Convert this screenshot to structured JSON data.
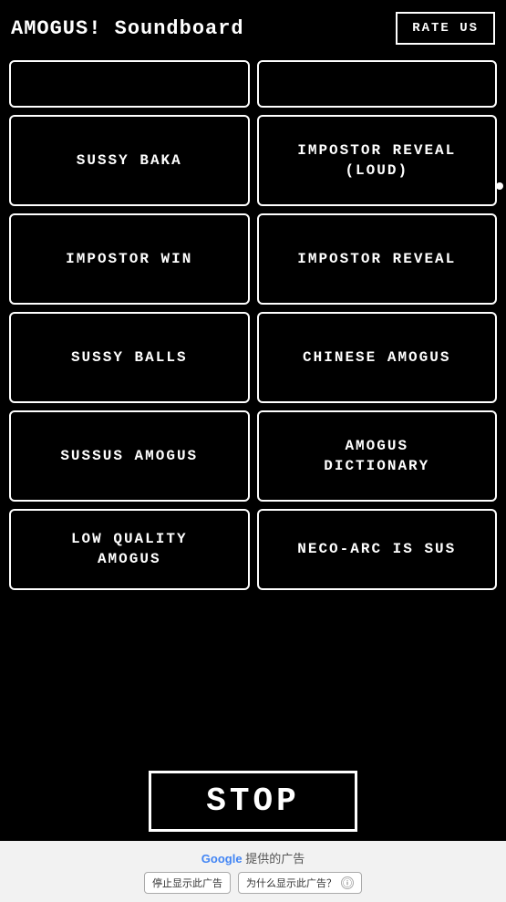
{
  "header": {
    "title": "AMOGUS! Soundboard",
    "rate_label": "RATE US"
  },
  "buttons": [
    {
      "id": "partial-left",
      "label": ""
    },
    {
      "id": "partial-right",
      "label": ""
    },
    {
      "id": "sussy-baka",
      "label": "SUSSY BAKA"
    },
    {
      "id": "impostor-reveal-loud",
      "label": "IMPOSTOR REVEAL\n(LOUD)"
    },
    {
      "id": "impostor-win",
      "label": "IMPOSTOR WIN"
    },
    {
      "id": "impostor-reveal",
      "label": "IMPOSTOR REVEAL"
    },
    {
      "id": "sussy-balls",
      "label": "SUSSY BALLS"
    },
    {
      "id": "chinese-amogus",
      "label": "CHINESE AMOGUS"
    },
    {
      "id": "sussus-amogus",
      "label": "SUSSUS AMOGUS"
    },
    {
      "id": "amogus-dictionary",
      "label": "AMOGUS\nDICTIONARY"
    },
    {
      "id": "low-quality-amogus",
      "label": "LOW QUALITY\nAMOGUS"
    },
    {
      "id": "neco-arc-is-sus",
      "label": "NECO-ARC IS SUS"
    }
  ],
  "stop": {
    "label": "STOP"
  },
  "ad": {
    "google_label": "Google",
    "provided_label": " 提供的广告",
    "stop_showing": "停止显示此广告",
    "why_showing": "为什么显示此广告？",
    "info_icon": "ⓘ"
  }
}
